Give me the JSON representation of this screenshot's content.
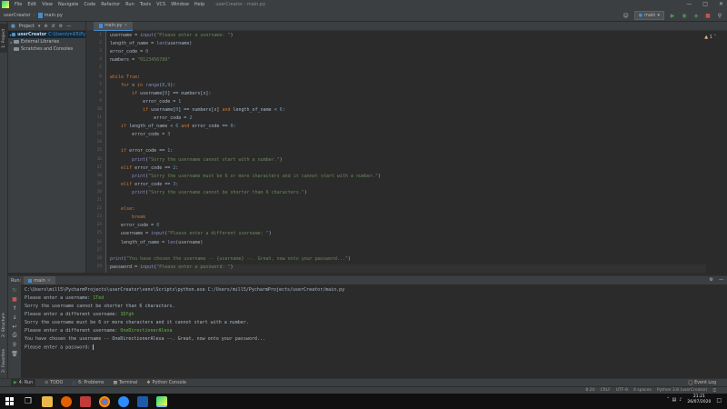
{
  "menubar": {
    "items": [
      "File",
      "Edit",
      "View",
      "Navigate",
      "Code",
      "Refactor",
      "Run",
      "Tools",
      "VCS",
      "Window",
      "Help"
    ],
    "title": "userCreator - main.py"
  },
  "navbar": {
    "project": "userCreator",
    "file": "main.py",
    "run_config": "main"
  },
  "project_panel": {
    "header": "Project",
    "tree": [
      {
        "name": "userCreator",
        "path": "C:\\Users\\mill5\\Py"
      },
      {
        "name": "External Libraries"
      },
      {
        "name": "Scratches and Consoles"
      }
    ]
  },
  "left_stripe": {
    "project_tab": "1: Project",
    "structure_tab": "2: Structure",
    "favorites_tab": "2: Favorites"
  },
  "editor": {
    "tab": "main.py",
    "warning_count": "1",
    "line_numbers": [
      "1",
      "2",
      "3",
      "4",
      "5",
      "6",
      "7",
      "8",
      "9",
      "10",
      "11",
      "12",
      "13",
      "14",
      "15",
      "16",
      "17",
      "18",
      "19",
      "20",
      "21",
      "22",
      "23",
      "24",
      "25",
      "26",
      "27",
      "28",
      "29"
    ]
  },
  "code": [
    [
      [
        "",
        "username = "
      ],
      [
        "fn",
        "input"
      ],
      [
        "",
        "("
      ],
      [
        "str",
        "\"Please enter a username: \""
      ],
      [
        "",
        ")"
      ]
    ],
    [
      [
        "",
        "length_of_name = "
      ],
      [
        "fn",
        "len"
      ],
      [
        "",
        "(username)"
      ]
    ],
    [
      [
        "",
        "error_code = "
      ],
      [
        "num",
        "0"
      ]
    ],
    [
      [
        "",
        "numbers = "
      ],
      [
        "str",
        "\"0123456789\""
      ]
    ],
    [],
    [
      [
        "kw",
        "while "
      ],
      [
        "kw",
        "True"
      ],
      [
        "",
        ":"
      ]
    ],
    [
      [
        "",
        "    "
      ],
      [
        "kw",
        "for "
      ],
      [
        "",
        "x "
      ],
      [
        "kw",
        "in "
      ],
      [
        "fn",
        "range"
      ],
      [
        "",
        "("
      ],
      [
        "num",
        "0"
      ],
      [
        "",
        ","
      ],
      [
        "num",
        "9"
      ],
      [
        "",
        "):"
      ]
    ],
    [
      [
        "",
        "        "
      ],
      [
        "kw",
        "if "
      ],
      [
        "",
        "username["
      ],
      [
        "num",
        "0"
      ],
      [
        "",
        "] == numbers[x]:"
      ]
    ],
    [
      [
        "",
        "            error_code = "
      ],
      [
        "num",
        "1"
      ]
    ],
    [
      [
        "",
        "            "
      ],
      [
        "kw",
        "if "
      ],
      [
        "",
        "username["
      ],
      [
        "num",
        "0"
      ],
      [
        "",
        "] == numbers[x] "
      ],
      [
        "kw",
        "and "
      ],
      [
        "",
        "length_of_name < "
      ],
      [
        "num",
        "6"
      ],
      [
        "",
        ":"
      ]
    ],
    [
      [
        "",
        "                error_code = "
      ],
      [
        "num",
        "2"
      ]
    ],
    [
      [
        "",
        "    "
      ],
      [
        "kw",
        "if "
      ],
      [
        "",
        "length_of_name < "
      ],
      [
        "num",
        "6"
      ],
      [
        "",
        " "
      ],
      [
        "kw",
        "and "
      ],
      [
        "",
        "error_code == "
      ],
      [
        "num",
        "0"
      ],
      [
        "",
        ":"
      ]
    ],
    [
      [
        "",
        "        error_code = "
      ],
      [
        "num",
        "3"
      ]
    ],
    [],
    [
      [
        "",
        "    "
      ],
      [
        "kw",
        "if "
      ],
      [
        "",
        "error_code == "
      ],
      [
        "num",
        "1"
      ],
      [
        "",
        ":"
      ]
    ],
    [
      [
        "",
        "        "
      ],
      [
        "fn",
        "print"
      ],
      [
        "",
        "("
      ],
      [
        "str",
        "\"Sorry the username cannot start with a number.\""
      ],
      [
        "",
        ")"
      ]
    ],
    [
      [
        "",
        "    "
      ],
      [
        "kw",
        "elif "
      ],
      [
        "",
        "error_code == "
      ],
      [
        "num",
        "2"
      ],
      [
        "",
        ":"
      ]
    ],
    [
      [
        "",
        "        "
      ],
      [
        "fn",
        "print"
      ],
      [
        "",
        "("
      ],
      [
        "str",
        "\"Sorry the username must be 6 or more characters and it cannot start with a number.\""
      ],
      [
        "",
        ")"
      ]
    ],
    [
      [
        "",
        "    "
      ],
      [
        "kw",
        "elif "
      ],
      [
        "",
        "error_code == "
      ],
      [
        "num",
        "3"
      ],
      [
        "",
        ":"
      ]
    ],
    [
      [
        "",
        "        "
      ],
      [
        "fn",
        "print"
      ],
      [
        "",
        "("
      ],
      [
        "str",
        "\"Sorry the username cannot be shorter than 6 characters.\""
      ],
      [
        "",
        ")"
      ]
    ],
    [],
    [
      [
        "",
        "    "
      ],
      [
        "kw",
        "else"
      ],
      [
        "",
        ":"
      ]
    ],
    [
      [
        "",
        "        "
      ],
      [
        "kw",
        "break"
      ]
    ],
    [
      [
        "",
        "    error_code = "
      ],
      [
        "num",
        "0"
      ]
    ],
    [
      [
        "",
        "    username = "
      ],
      [
        "fn",
        "input"
      ],
      [
        "",
        "("
      ],
      [
        "str",
        "\"Please enter a different username: \""
      ],
      [
        "",
        ")"
      ]
    ],
    [
      [
        "",
        "    length_of_name = "
      ],
      [
        "fn",
        "len"
      ],
      [
        "",
        "(username)"
      ]
    ],
    [],
    [
      [
        "fn",
        "print"
      ],
      [
        "",
        "("
      ],
      [
        "str",
        "\"You have chosen the username -- {username} --. Great, now onto your password...\""
      ],
      [
        "",
        ")"
      ]
    ],
    [
      [
        "",
        "password = "
      ],
      [
        "fn",
        "input"
      ],
      [
        "",
        "("
      ],
      [
        "str",
        "\"Please enter a password: \""
      ],
      [
        "",
        ")"
      ]
    ]
  ],
  "run_panel": {
    "label": "Run:",
    "tab": "main"
  },
  "console": [
    {
      "text": "C:\\Users\\mill5\\PycharmProjects\\userCreator\\venv\\Scripts\\python.exe C:/Users/mill5/PycharmProjects/userCreator/main.py",
      "input": ""
    },
    {
      "text": "Please enter a username: ",
      "input": "1Ted"
    },
    {
      "text": "Sorry the username cannot be shorter than 6 characters.",
      "input": ""
    },
    {
      "text": "Please enter a different username: ",
      "input": "1Dfgh"
    },
    {
      "text": "Sorry the username must be 6 or more characters and it cannot start with a number.",
      "input": ""
    },
    {
      "text": "Please enter a different username: ",
      "input": "OneDirectionerAlexa"
    },
    {
      "text": "You have chosen the username -- OneDirectionerAlexa --. Great, now onto your password...",
      "input": ""
    },
    {
      "text": "Please enter a password: ",
      "input": "",
      "cursor": true
    }
  ],
  "toolbar": {
    "run": "4: Run",
    "todo": "TODO",
    "problems": "6: Problems",
    "terminal": "Terminal",
    "python_console": "Python Console",
    "event_log": "Event Log"
  },
  "status": {
    "position": "8:20",
    "line_sep": "CRLF",
    "encoding": "UTF-8",
    "indent": "4 spaces",
    "interpreter": "Python 3.8 (userCreator)"
  },
  "taskbar": {
    "time": "21:21",
    "date": "26/07/2020"
  },
  "colors": {
    "keyword": "#cc7832",
    "string": "#6a8759",
    "number": "#6897bb",
    "builtin": "#8888c6",
    "user_input": "#62b543"
  }
}
